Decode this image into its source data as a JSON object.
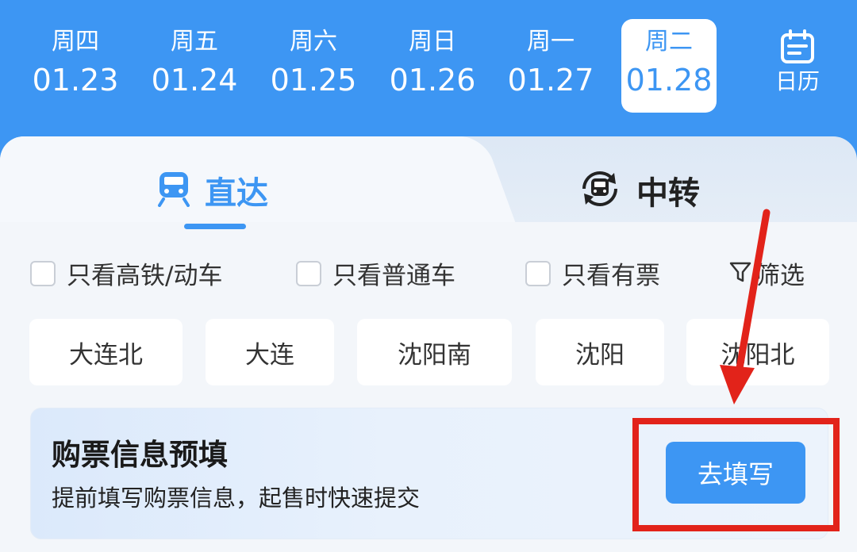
{
  "date_bar": {
    "days": [
      {
        "weekday": "周四",
        "date": "01.23",
        "selected": false
      },
      {
        "weekday": "周五",
        "date": "01.24",
        "selected": false
      },
      {
        "weekday": "周六",
        "date": "01.25",
        "selected": false
      },
      {
        "weekday": "周日",
        "date": "01.26",
        "selected": false
      },
      {
        "weekday": "周一",
        "date": "01.27",
        "selected": false
      },
      {
        "weekday": "周二",
        "date": "01.28",
        "selected": true
      }
    ],
    "calendar_label": "日历",
    "calendar_icon": "calendar-icon"
  },
  "tabs": {
    "direct": {
      "label": "直达",
      "icon": "train-icon",
      "active": true
    },
    "transfer": {
      "label": "中转",
      "icon": "transfer-train-icon",
      "active": false
    }
  },
  "filters": {
    "options": [
      {
        "label": "只看高铁/动车",
        "checked": false
      },
      {
        "label": "只看普通车",
        "checked": false
      },
      {
        "label": "只看有票",
        "checked": false
      }
    ],
    "screen_label": "筛选",
    "screen_icon": "filter-icon"
  },
  "stations": [
    "大连北",
    "大连",
    "沈阳南",
    "沈阳",
    "沈阳北"
  ],
  "prefill": {
    "title": "购票信息预填",
    "subtitle": "提前填写购票信息，起售时快速提交",
    "button_label": "去填写"
  },
  "colors": {
    "accent": "#3d96f3",
    "annotation": "#e2231a"
  }
}
